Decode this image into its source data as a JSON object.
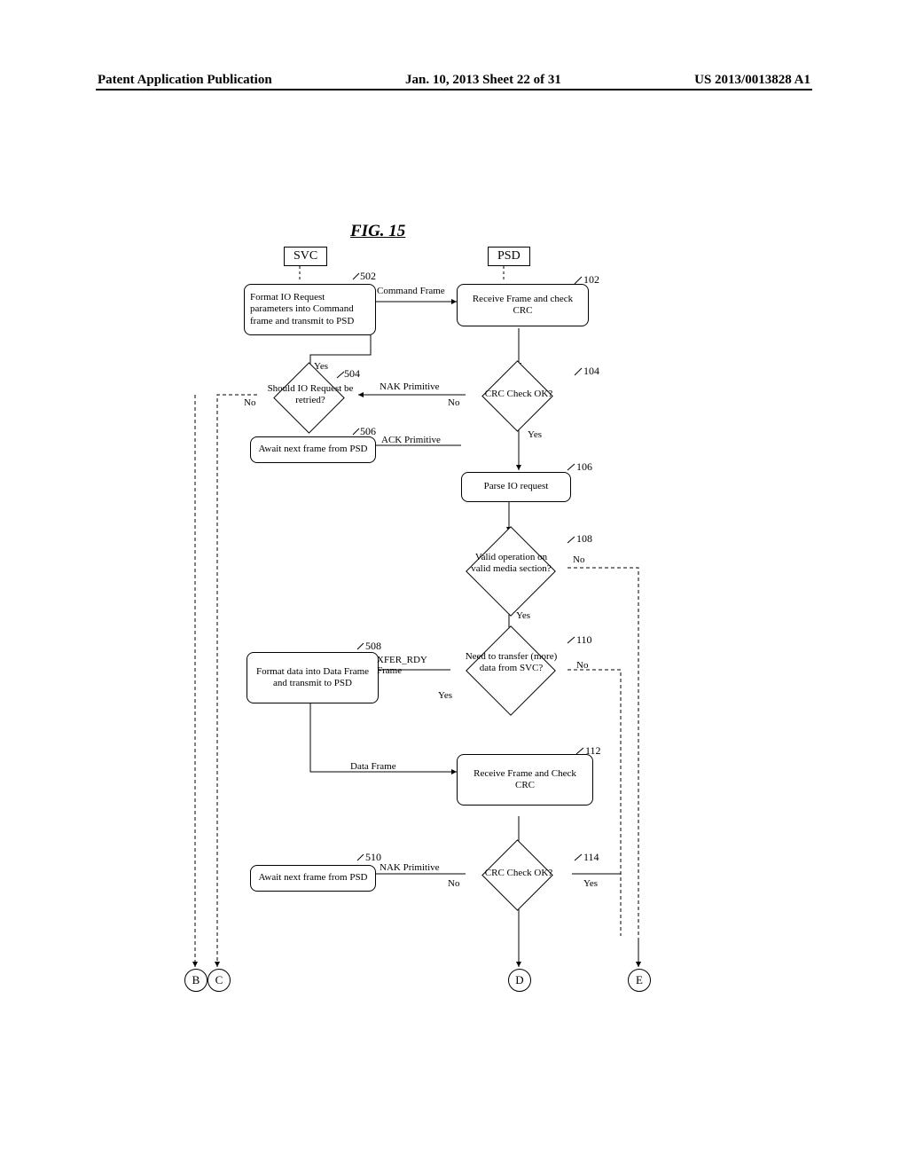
{
  "header": {
    "left": "Patent Application Publication",
    "center": "Jan. 10, 2013  Sheet 22 of 31",
    "right": "US 2013/0013828 A1"
  },
  "figure": {
    "title": "FIG. 15"
  },
  "lanes": {
    "svc": "SVC",
    "psd": "PSD"
  },
  "svc_boxes": {
    "b502": "Format IO Request parameters into Command frame and transmit to PSD",
    "b504": "Should IO Request be retried?",
    "b506": "Await next frame from PSD",
    "b508": "Format data into Data Frame and transmit to PSD",
    "b510": "Await next frame from PSD"
  },
  "psd_boxes": {
    "b102": "Receive Frame and check CRC",
    "b104": "CRC Check OK?",
    "b106": "Parse IO request",
    "b108": "Valid operation on valid media section?",
    "b110": "Need to transfer (more) data from SVC?",
    "b112": "Receive Frame and Check CRC",
    "b114": "CRC Check OK?"
  },
  "edge_labels": {
    "command_frame": "Command Frame",
    "nak_primitive": "NAK Primitive",
    "ack_primitive": "ACK Primitive",
    "xfer_rdy": "XFER_RDY Frame",
    "data_frame": "Data Frame",
    "nak_primitive2": "NAK Primitive",
    "yes": "Yes",
    "no": "No"
  },
  "refs": {
    "r502": "502",
    "r504": "504",
    "r506": "506",
    "r508": "508",
    "r510": "510",
    "r102": "102",
    "r104": "104",
    "r106": "106",
    "r108": "108",
    "r110": "110",
    "r112": "112",
    "r114": "114"
  },
  "connectors": {
    "B": "B",
    "C": "C",
    "D": "D",
    "E": "E"
  }
}
